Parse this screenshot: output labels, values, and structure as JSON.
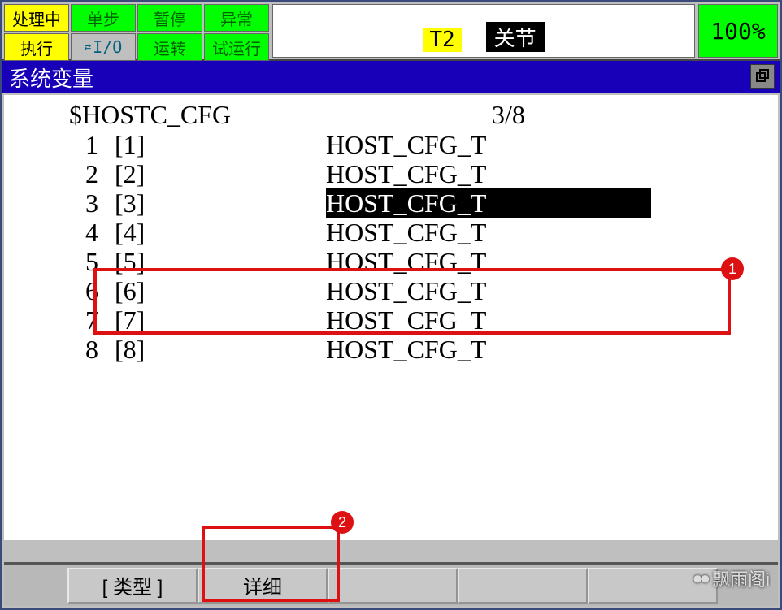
{
  "topbar": {
    "proc": "处理中",
    "step": "单步",
    "pause": "暂停",
    "abnorm": "异常",
    "exec": "执行",
    "io": "I/O",
    "run": "运转",
    "trial": "试运行"
  },
  "status": {
    "mode": "T2",
    "coord": "关节",
    "pct": "100%"
  },
  "title": "系统变量",
  "var": {
    "name": "$HOSTC_CFG",
    "pos": "3/8",
    "selected_index": 3,
    "rows": [
      {
        "idx": "1",
        "br": "[1]",
        "val": "HOST_CFG_T"
      },
      {
        "idx": "2",
        "br": "[2]",
        "val": "HOST_CFG_T"
      },
      {
        "idx": "3",
        "br": "[3]",
        "val": "HOST_CFG_T"
      },
      {
        "idx": "4",
        "br": "[4]",
        "val": "HOST_CFG_T"
      },
      {
        "idx": "5",
        "br": "[5]",
        "val": "HOST_CFG_T"
      },
      {
        "idx": "6",
        "br": "[6]",
        "val": "HOST_CFG_T"
      },
      {
        "idx": "7",
        "br": "[7]",
        "val": "HOST_CFG_T"
      },
      {
        "idx": "8",
        "br": "[8]",
        "val": "HOST_CFG_T"
      }
    ]
  },
  "fkeys": {
    "type": "[ 类型 ]",
    "detail": "详细"
  },
  "annotations": {
    "a1": "1",
    "a2": "2"
  },
  "watermark": "飘雨阁i"
}
